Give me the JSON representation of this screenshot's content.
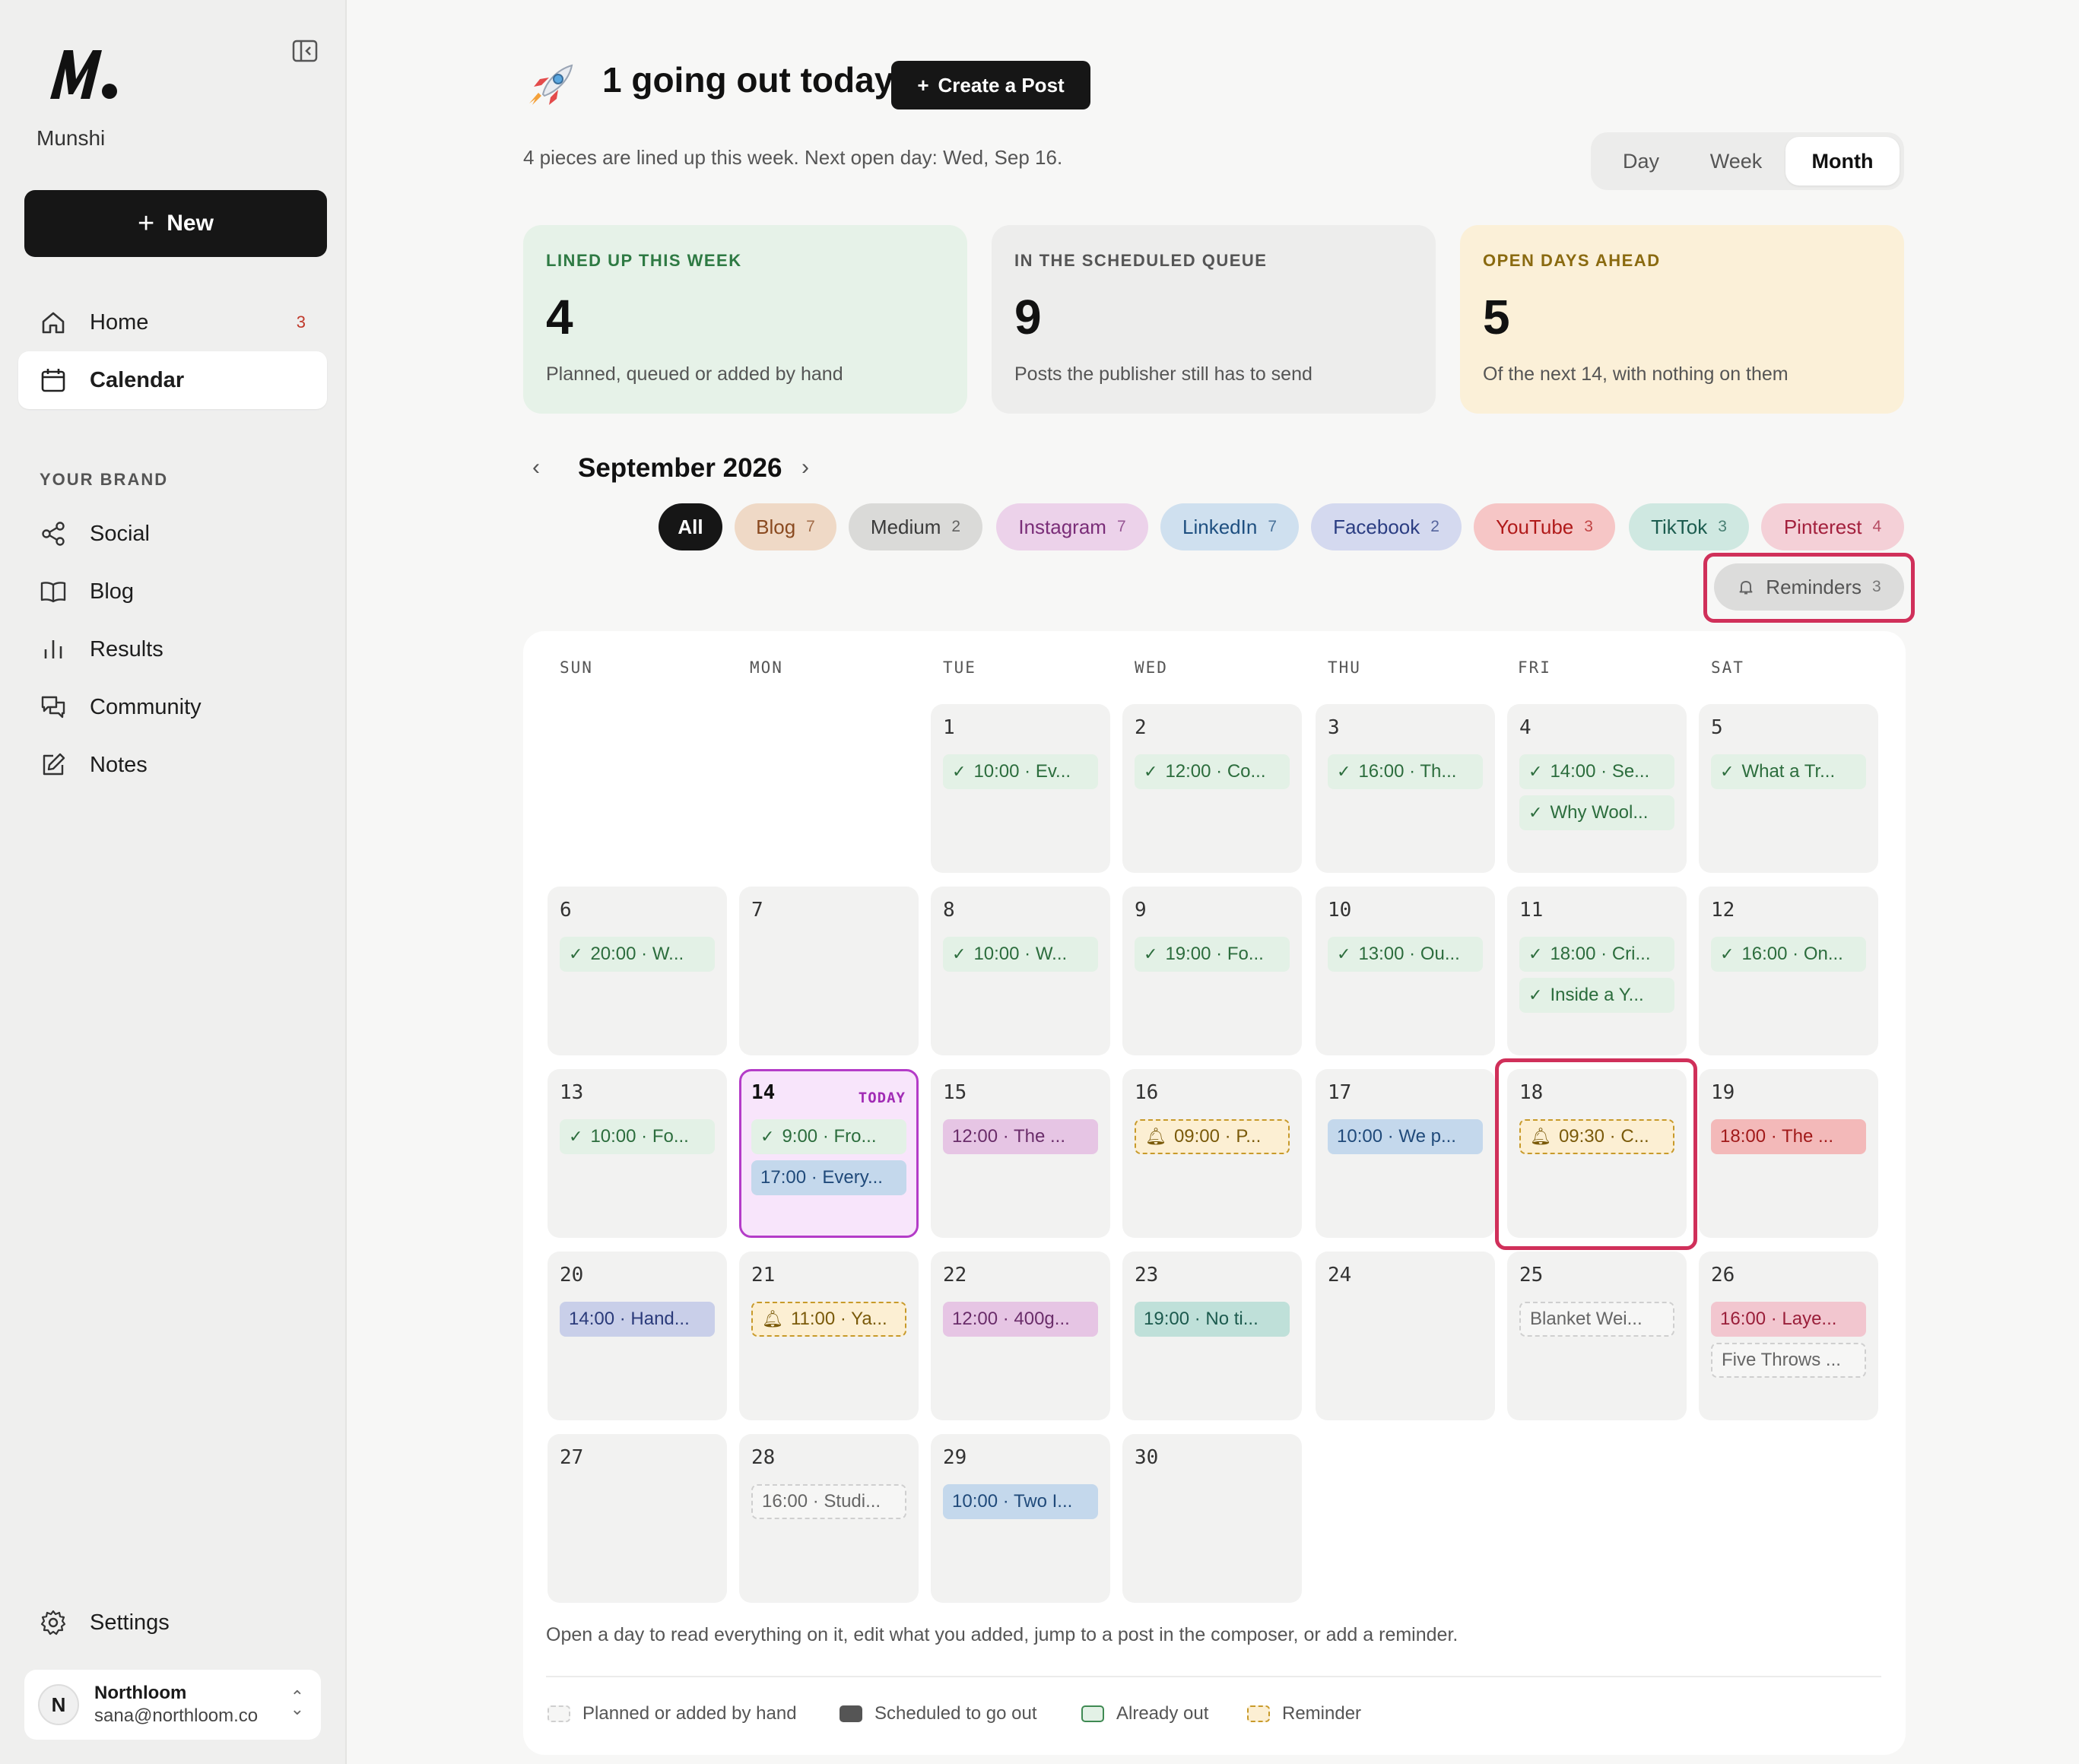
{
  "sidebar": {
    "brand": "Munshi",
    "new_label": "New",
    "nav": [
      {
        "label": "Home",
        "badge": "3"
      },
      {
        "label": "Calendar"
      }
    ],
    "section_label": "YOUR BRAND",
    "brand_nav": [
      {
        "label": "Social"
      },
      {
        "label": "Blog"
      },
      {
        "label": "Results"
      },
      {
        "label": "Community"
      },
      {
        "label": "Notes"
      }
    ],
    "settings_label": "Settings",
    "account": {
      "initial": "N",
      "name": "Northloom",
      "email": "sana@northloom.co"
    }
  },
  "header": {
    "headline": "1 going out today",
    "create_label": "Create a Post",
    "subline": "4 pieces are lined up this week. Next open day: Wed, Sep 16.",
    "views": [
      "Day",
      "Week",
      "Month"
    ],
    "active_view": "Month"
  },
  "stats": [
    {
      "label": "LINED UP THIS WEEK",
      "value": "4",
      "desc": "Planned, queued or added by hand"
    },
    {
      "label": "IN THE SCHEDULED QUEUE",
      "value": "9",
      "desc": "Posts the publisher still has to send"
    },
    {
      "label": "OPEN DAYS AHEAD",
      "value": "5",
      "desc": "Of the next 14, with nothing on them"
    }
  ],
  "calendar": {
    "month_title": "September 2026",
    "filters": [
      {
        "label": "All"
      },
      {
        "label": "Blog",
        "count": "7"
      },
      {
        "label": "Medium",
        "count": "2"
      },
      {
        "label": "Instagram",
        "count": "7"
      },
      {
        "label": "LinkedIn",
        "count": "7"
      },
      {
        "label": "Facebook",
        "count": "2"
      },
      {
        "label": "YouTube",
        "count": "3"
      },
      {
        "label": "TikTok",
        "count": "3"
      },
      {
        "label": "Pinterest",
        "count": "4"
      }
    ],
    "reminders": {
      "label": "Reminders",
      "count": "3"
    },
    "weekdays": [
      "SUN",
      "MON",
      "TUE",
      "WED",
      "THU",
      "FRI",
      "SAT"
    ],
    "today_tag": "TODAY",
    "days": {
      "d1": {
        "n": "1",
        "events": [
          "10:00 · Ev..."
        ]
      },
      "d2": {
        "n": "2",
        "events": [
          "12:00 · Co..."
        ]
      },
      "d3": {
        "n": "3",
        "events": [
          "16:00 · Th..."
        ]
      },
      "d4": {
        "n": "4",
        "events": [
          "14:00 · Se...",
          "Why Wool..."
        ]
      },
      "d5": {
        "n": "5",
        "events": [
          "What a Tr..."
        ]
      },
      "d6": {
        "n": "6",
        "events": [
          "20:00 · W..."
        ]
      },
      "d7": {
        "n": "7",
        "events": []
      },
      "d8": {
        "n": "8",
        "events": [
          "10:00 · W..."
        ]
      },
      "d9": {
        "n": "9",
        "events": [
          "19:00 · Fo..."
        ]
      },
      "d10": {
        "n": "10",
        "events": [
          "13:00 · Ou..."
        ]
      },
      "d11": {
        "n": "11",
        "events": [
          "18:00 · Cri...",
          "Inside a Y..."
        ]
      },
      "d12": {
        "n": "12",
        "events": [
          "16:00 · On..."
        ]
      },
      "d13": {
        "n": "13",
        "events": [
          "10:00 · Fo..."
        ]
      },
      "d14": {
        "n": "14",
        "events": [
          "9:00 · Fro...",
          "17:00 · Every..."
        ]
      },
      "d15": {
        "n": "15",
        "events": [
          "12:00 · The ..."
        ]
      },
      "d16": {
        "n": "16",
        "events": [
          "09:00 · P..."
        ]
      },
      "d17": {
        "n": "17",
        "events": [
          "10:00 · We p..."
        ]
      },
      "d18": {
        "n": "18",
        "events": [
          "09:30 · C..."
        ]
      },
      "d19": {
        "n": "19",
        "events": [
          "18:00 · The ..."
        ]
      },
      "d20": {
        "n": "20",
        "events": [
          "14:00 · Hand..."
        ]
      },
      "d21": {
        "n": "21",
        "events": [
          "11:00 · Ya..."
        ]
      },
      "d22": {
        "n": "22",
        "events": [
          "12:00 · 400g..."
        ]
      },
      "d23": {
        "n": "23",
        "events": [
          "19:00 · No ti..."
        ]
      },
      "d24": {
        "n": "24",
        "events": []
      },
      "d25": {
        "n": "25",
        "events": [
          "Blanket Wei..."
        ]
      },
      "d26": {
        "n": "26",
        "events": [
          "16:00 · Laye...",
          "Five Throws ..."
        ]
      },
      "d27": {
        "n": "27",
        "events": []
      },
      "d28": {
        "n": "28",
        "events": [
          "16:00 · Studi..."
        ]
      },
      "d29": {
        "n": "29",
        "events": [
          "10:00 · Two I..."
        ]
      },
      "d30": {
        "n": "30",
        "events": []
      }
    },
    "help_text": "Open a day to read everything on it, edit what you added, jump to a post in the composer, or add a reminder.",
    "legend": [
      {
        "label": "Planned or added by hand"
      },
      {
        "label": "Scheduled to go out"
      },
      {
        "label": "Already out"
      },
      {
        "label": "Reminder"
      }
    ]
  },
  "colors": {
    "accent_highlight": "#d0305a",
    "today": "#b43cc8",
    "already_out": "#2c6d3d",
    "reminder": "#c89a2a"
  }
}
